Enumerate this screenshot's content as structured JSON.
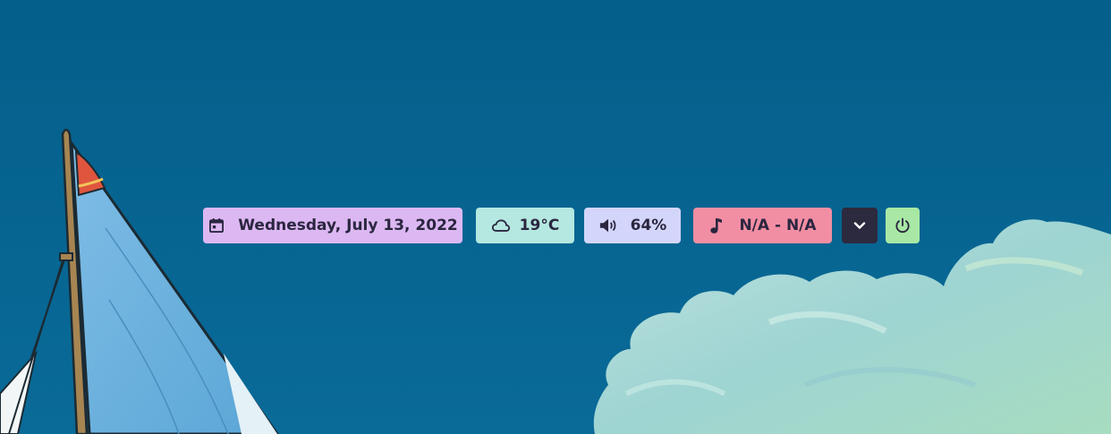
{
  "colors": {
    "background": "#05648f",
    "date_pill": "#dcb8f2",
    "weather_pill": "#b4e8e0",
    "volume_pill": "#d3d6fa",
    "music_pill": "#f28ea3",
    "expand_pill": "#2c2a3e",
    "power_pill": "#a8e8a4",
    "text": "#2b2640"
  },
  "bar": {
    "date": {
      "icon": "calendar-icon",
      "label": "Wednesday, July 13, 2022"
    },
    "weather": {
      "icon": "cloud-icon",
      "label": "19°C"
    },
    "volume": {
      "icon": "speaker-icon",
      "label": "64%"
    },
    "music": {
      "icon": "music-note-icon",
      "label": "N/A - N/A"
    },
    "expand": {
      "icon": "chevron-down-icon"
    },
    "power": {
      "icon": "power-icon"
    }
  }
}
